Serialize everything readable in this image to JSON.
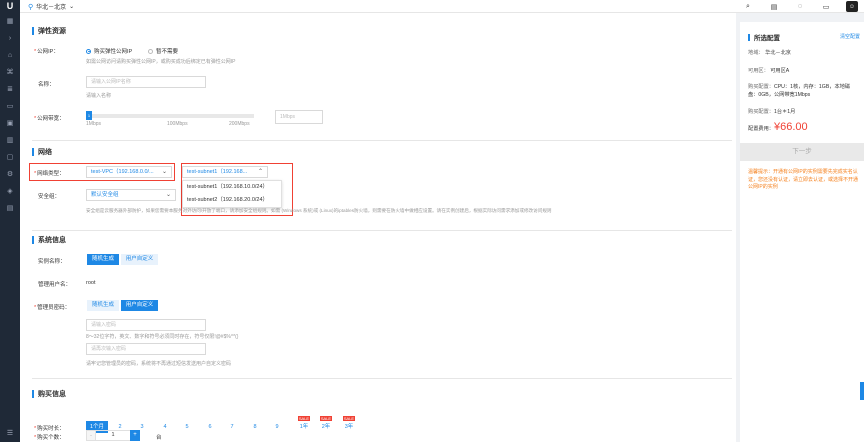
{
  "topbar": {
    "region": "华北－北京",
    "icons": [
      "search-icon",
      "document-icon",
      "chat-icon",
      "clipboard-icon",
      "user-avatar-icon"
    ]
  },
  "sidebar": {
    "icons": [
      "grid-icon",
      "chevron-right-icon",
      "building-icon",
      "network-icon",
      "layers-icon",
      "database-icon",
      "box-icon",
      "chart-icon",
      "monitor-icon",
      "settings-icon",
      "shield-icon",
      "image-icon",
      "menu-icon"
    ]
  },
  "eip": {
    "title": "弹性资源",
    "public_ip_label": "公网IP：",
    "option_buy": "购买弹性公网IP",
    "option_none": "暂不需要",
    "hint": "如需公网访问请购买弹性公网IP，或购买成功后绑定已有弹性公网IP",
    "name_label": "名称：",
    "name_placeholder": "请输入公网IP名称",
    "name_hint": "请输入名称",
    "bandwidth_label": "公网带宽：",
    "bandwidth_value": "1",
    "ticks": [
      "1Mbps",
      "100Mbps",
      "200Mbps"
    ],
    "bandwidth_input": "1Mbps"
  },
  "network": {
    "title": "网络",
    "type_label": "网络类型：",
    "vpc_value": "test-VPC（192.168.0.0/...",
    "subnet_value": "test-subnet1（192.168...",
    "subnet_options": [
      "test-subnet1（192.168.10.0/24）",
      "test-subnet2（192.168.20.0/24）"
    ],
    "sg_label": "安全组：",
    "sg_value": "默认安全组",
    "sg_hint": "安全组是云服务器外部防护，如果您需要本服务对外访问/开放了端口，请添加安全组规则。如需 (Windows 系统)或 (Linux)的iptables防火墙，则需要在防火墙中做相应设置。请在实例创建后，根据实际访问需求添加或修改访问规则"
  },
  "system": {
    "title": "系统信息",
    "instance_name_label": "实例名称：",
    "btn_random": "随机生成",
    "btn_custom": "用户自定义",
    "admin_user_label": "管理用户名：",
    "admin_user_value": "root",
    "admin_pwd_label": "管理员密码：",
    "pwd_placeholder": "请输入密码",
    "pwd_rule": "8～32位字符，英文、数字和符号必须同时存在，符号仅限!@#$%^*()",
    "pwd_confirm_placeholder": "请再次输入密码",
    "pwd_warning": "请牢记您管理员的密码，系统将不再通过短信发送用户自定义密码"
  },
  "purchase": {
    "title": "购买信息",
    "duration_label": "购买时长：",
    "durations": [
      "1个月",
      "2",
      "3",
      "4",
      "5",
      "6",
      "7",
      "8",
      "9",
      "1年",
      "2年",
      "3年"
    ],
    "sale_tag": "SALE",
    "count_label": "购买个数：",
    "count_value": "1",
    "count_unit": "台",
    "minus": "-",
    "plus": "+"
  },
  "summary": {
    "title": "所选配置",
    "clear": "清空配置",
    "region_k": "地域：",
    "region_v": "华北－北京",
    "zone_k": "可用区：",
    "zone_v": "可用区A",
    "spec_k": "购买配置：",
    "spec_v": "CPU：1核，内存：1GB，本地磁盘：0GB，公网带宽1Mbps",
    "qty_k": "购买配置：",
    "qty_v": "1台＊1月",
    "price_k": "配置费用：",
    "price": "¥66.00",
    "next": "下一步",
    "tip": "温馨提示：开通有公网IP的实例需要先完成实名认证，您还没有认证，请立即去认证，或选择不开通公网IP的实例"
  }
}
